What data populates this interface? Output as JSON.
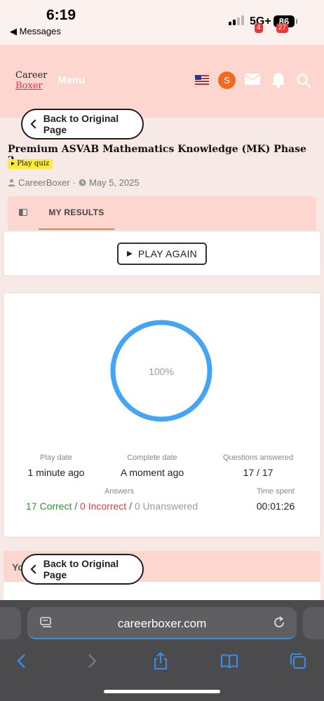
{
  "status_bar": {
    "time": "6:19",
    "back_app": "◀ Messages",
    "network": "5G+",
    "battery": "86"
  },
  "header": {
    "logo_line1": "Career",
    "logo_line2": "Boxer",
    "menu_label": "Menu",
    "avatar_letter": "S",
    "mail_badge": "4",
    "bell_badge": "27"
  },
  "back_button_label": "Back to Original Page",
  "quiz": {
    "title": "Premium ASVAB Mathematics Knowledge (MK) Phase 2",
    "tag": "Play quiz",
    "author": "CareerBoxer",
    "separator": "·",
    "date": "May 5, 2025"
  },
  "tabs": {
    "results_label": "MY RESULTS"
  },
  "play_again_label": "PLAY AGAIN",
  "results": {
    "score_label": "100%",
    "score_fraction": 1.0,
    "play_date_label": "Play date",
    "play_date_value": "1 minute ago",
    "complete_date_label": "Complete date",
    "complete_date_value": "A moment ago",
    "questions_label": "Questions answered",
    "questions_value": "17 / 17",
    "answers_label": "Answers",
    "correct": "17 Correct",
    "incorrect": "0 Incorrect",
    "unanswered": "0 Unanswered",
    "slash": "/",
    "time_label": "Time spent",
    "time_value": "00:01:26",
    "ring_color": "#42a5f5"
  },
  "bottom_card_title": "Yo",
  "browser": {
    "url": "careerboxer.com"
  }
}
